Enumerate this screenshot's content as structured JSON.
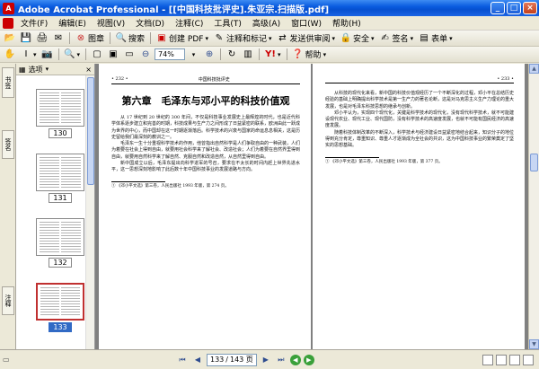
{
  "window": {
    "title": "Adobe Acrobat Professional - [[中国科技批评史].朱亚宗.扫描版.pdf]",
    "buttons": {
      "minimize": "_",
      "maximize": "□",
      "close": "×"
    }
  },
  "menu": [
    "文件(F)",
    "编辑(E)",
    "视图(V)",
    "文档(D)",
    "注释(C)",
    "工具(T)",
    "高级(A)",
    "窗口(W)",
    "帮助(H)"
  ],
  "toolbar1": {
    "stamp": "图章",
    "search": "搜索",
    "create_pdf": "创建 PDF",
    "comment": "注释和标记",
    "send_review": "发送供审阅",
    "security": "安全",
    "sign": "签名",
    "forms": "表单"
  },
  "toolbar2": {
    "zoom": "74%",
    "help": "帮助"
  },
  "thumbnails": {
    "options_label": "选项",
    "items": [
      {
        "label": "130",
        "selected": false
      },
      {
        "label": "131",
        "selected": false
      },
      {
        "label": "132",
        "selected": false
      },
      {
        "label": "133",
        "selected": true
      }
    ]
  },
  "left_tabs": [
    "书签",
    "签名",
    "注释"
  ],
  "pages": {
    "left": {
      "header_left": "• 232 •",
      "header_center": "中国科技批评史",
      "chapter_title": "第六章　毛泽东与邓小平的科技价值观",
      "paragraphs": [
        "从 17 世纪到 20 世纪的 300 年间，不仅是科技事业发展史上最辉煌的时代，也是近代科学体系逐步建立和完善的时期，科技成果与生产力之间形成了日益紧密的联系，欧洲由此一跃成为世界的中心，而中国却在这一时期逐渐落后。科学技术的兴衰与国家的命运息息相关，这是历史留给我们最深刻的教训之一。",
        "毛泽东一生十分重视科学技术的作用，他曾指出自然科学是人们争取自由的一种武装，人们为着要在社会上得到自由，就要用社会科学来了解社会、改造社会；人们为着要在自然界里得到自由，就要用自然科学来了解自然、克服自然和改造自然，从自然里得到自由。",
        "新中国成立以后，毛泽东提出向科学进军的号召，要求在不太长的时间内赶上世界先进水平，这一思想深刻地影响了此后数十年中国科技事业的发展道路与方向。"
      ],
      "footnote": "① 《邓小平文选》第三卷，人民出版社 1993 年版，第 274 页。"
    },
    "right": {
      "header_right": "• 233 •",
      "paragraphs": [
        "从科技的现代化来看，新中国的科技价值观经历了一个不断深化的过程，邓小平在总结历史经验的基础上明确提出科学技术是第一生产力的著名论断，这是对马克思主义生产力理论的重大发展，也是对毛泽东科技思想的继承与创新。",
        "邓小平认为，实现四个现代化，关键是科学技术的现代化，没有现代科学技术，就不可能建设现代农业、现代工业、现代国防，没有科学技术的高速度发展，也就不可能有国民经济的高速度发展。",
        "随着科技体制改革的不断深入，科学技术与经济建设日益紧密地结合起来，知识分子的地位得到充分肯定，尊重知识、尊重人才逐渐成为全社会的共识，这为中国科技事业的繁荣奠定了坚实的思想基础。"
      ],
      "footnote": "① 《邓小平文选》第三卷，人民出版社 1993 年版，第 377 页。"
    }
  },
  "status": {
    "page_current": "133",
    "page_total": "143 页"
  }
}
